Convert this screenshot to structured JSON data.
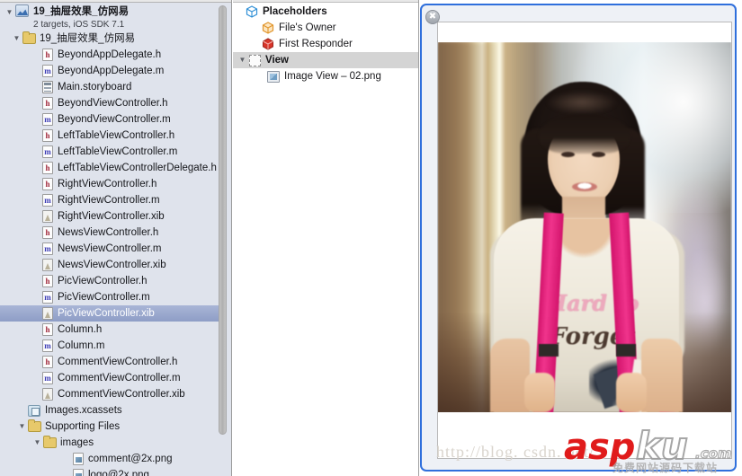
{
  "navigator": {
    "project": {
      "name": "19_抽屉效果_仿网易",
      "subtitle": "2 targets, iOS SDK 7.1",
      "icon": "xcode-project-icon"
    },
    "group": {
      "name": "19_抽屉效果_仿网易",
      "icon": "folder-icon"
    },
    "files": [
      {
        "name": "BeyondAppDelegate.h",
        "icon": "header-file-icon"
      },
      {
        "name": "BeyondAppDelegate.m",
        "icon": "implementation-file-icon"
      },
      {
        "name": "Main.storyboard",
        "icon": "storyboard-file-icon"
      },
      {
        "name": "BeyondViewController.h",
        "icon": "header-file-icon"
      },
      {
        "name": "BeyondViewController.m",
        "icon": "implementation-file-icon"
      },
      {
        "name": "LeftTableViewController.h",
        "icon": "header-file-icon"
      },
      {
        "name": "LeftTableViewController.m",
        "icon": "implementation-file-icon"
      },
      {
        "name": "LeftTableViewControllerDelegate.h",
        "icon": "header-file-icon"
      },
      {
        "name": "RightViewController.h",
        "icon": "header-file-icon"
      },
      {
        "name": "RightViewController.m",
        "icon": "implementation-file-icon"
      },
      {
        "name": "RightViewController.xib",
        "icon": "xib-file-icon"
      },
      {
        "name": "NewsViewController.h",
        "icon": "header-file-icon"
      },
      {
        "name": "NewsViewController.m",
        "icon": "implementation-file-icon"
      },
      {
        "name": "NewsViewController.xib",
        "icon": "xib-file-icon"
      },
      {
        "name": "PicViewController.h",
        "icon": "header-file-icon"
      },
      {
        "name": "PicViewController.m",
        "icon": "implementation-file-icon"
      },
      {
        "name": "PicViewController.xib",
        "icon": "xib-file-icon",
        "selected": true
      },
      {
        "name": "Column.h",
        "icon": "header-file-icon"
      },
      {
        "name": "Column.m",
        "icon": "implementation-file-icon"
      },
      {
        "name": "CommentViewController.h",
        "icon": "header-file-icon"
      },
      {
        "name": "CommentViewController.m",
        "icon": "implementation-file-icon"
      },
      {
        "name": "CommentViewController.xib",
        "icon": "xib-file-icon"
      },
      {
        "name": "Images.xcassets",
        "icon": "asset-catalog-icon"
      }
    ],
    "supporting_files": {
      "name": "Supporting Files",
      "icon": "folder-icon"
    },
    "images_folder": {
      "name": "images",
      "icon": "folder-icon"
    },
    "image_files": [
      {
        "name": "comment@2x.png",
        "icon": "png-file-icon"
      },
      {
        "name": "logo@2x.png",
        "icon": "png-file-icon"
      }
    ]
  },
  "outline": {
    "placeholders": {
      "label": "Placeholders",
      "icon": "cube-blue-icon"
    },
    "items": [
      {
        "label": "File's Owner",
        "icon": "cube-orange-icon"
      },
      {
        "label": "First Responder",
        "icon": "cube-red-icon"
      }
    ],
    "view": {
      "label": "View",
      "icon": "dashed-box-icon"
    },
    "children": [
      {
        "label": "Image View – 02.png",
        "icon": "image-view-icon"
      }
    ]
  },
  "preview": {
    "close_label": "✖",
    "close_icon": "close-icon",
    "image_name": "02.png",
    "tee_text_line1": "Hard to",
    "tee_text_line2": "Forget",
    "border_color": "#2f6fdc"
  },
  "watermarks": {
    "url": "http://blog. csdn. net/",
    "brand_red": "asp",
    "brand_gray": "ku",
    "brand_tld": ".com",
    "brand_subtitle": "免费网站源码下载站",
    "red_hex": "#e01b1b"
  }
}
